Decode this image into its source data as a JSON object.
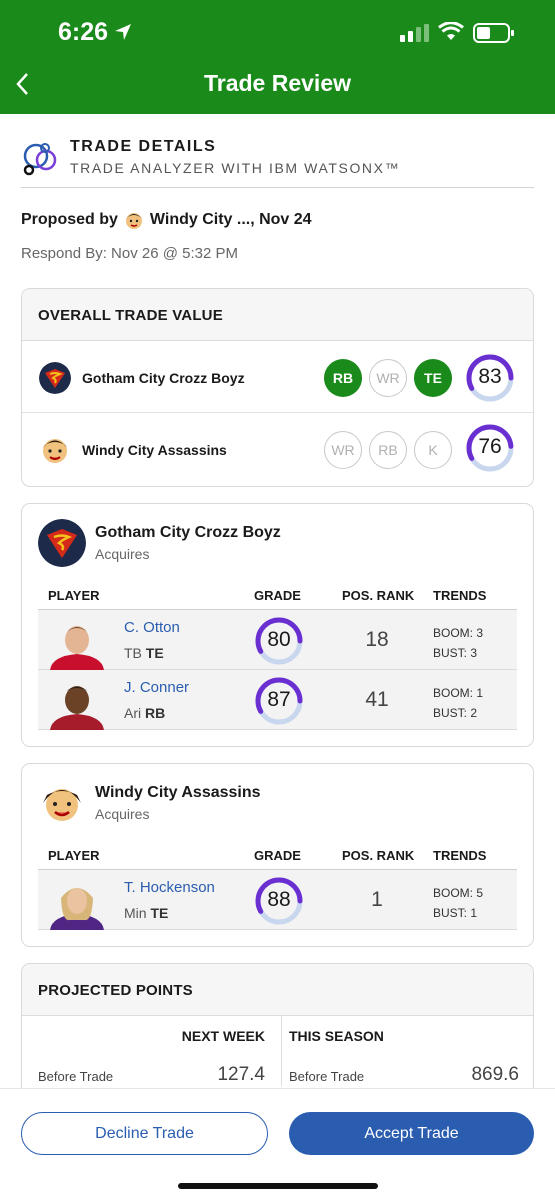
{
  "status_bar": {
    "time": "6:26"
  },
  "nav": {
    "title": "Trade Review"
  },
  "trade_details": {
    "title": "TRADE DETAILS",
    "subtitle": "TRADE ANALYZER WITH IBM WATSONX™"
  },
  "proposed": {
    "prefix": "Proposed by",
    "team": "Windy City ..., Nov 24"
  },
  "respond_by": "Respond By: Nov 26 @ 5:32 PM",
  "overall_trade_value": {
    "title": "OVERALL TRADE VALUE",
    "rows": [
      {
        "team": "Gotham City Crozz Boyz",
        "positions": [
          "RB",
          "WR",
          "TE"
        ],
        "active": [
          true,
          false,
          true
        ],
        "score": "83"
      },
      {
        "team": "Windy City Assassins",
        "positions": [
          "WR",
          "RB",
          "K"
        ],
        "active": [
          false,
          false,
          false
        ],
        "score": "76"
      }
    ]
  },
  "acquisitions": [
    {
      "team": "Gotham City Crozz Boyz",
      "label": "Acquires",
      "headers": {
        "player": "PLAYER",
        "grade": "GRADE",
        "rank": "POS. RANK",
        "trends": "TRENDS"
      },
      "players": [
        {
          "name": "C. Otton",
          "team": "TB",
          "pos": "TE",
          "grade": "80",
          "rank": "18",
          "boom": "BOOM: 3",
          "bust": "BUST: 3"
        },
        {
          "name": "J. Conner",
          "team": "Ari",
          "pos": "RB",
          "grade": "87",
          "rank": "41",
          "boom": "BOOM: 1",
          "bust": "BUST: 2"
        }
      ]
    },
    {
      "team": "Windy City Assassins",
      "label": "Acquires",
      "headers": {
        "player": "PLAYER",
        "grade": "GRADE",
        "rank": "POS. RANK",
        "trends": "TRENDS"
      },
      "players": [
        {
          "name": "T. Hockenson",
          "team": "Min",
          "pos": "TE",
          "grade": "88",
          "rank": "1",
          "boom": "BOOM: 5",
          "bust": "BUST: 1"
        }
      ]
    }
  ],
  "projected_points": {
    "title": "PROJECTED POINTS",
    "next_week": {
      "header": "NEXT WEEK",
      "label": "Before Trade",
      "value": "127.4"
    },
    "this_season": {
      "header": "THIS SEASON",
      "label": "Before Trade",
      "value": "869.6"
    }
  },
  "actions": {
    "decline": "Decline Trade",
    "accept": "Accept Trade"
  },
  "colors": {
    "header_green": "#1a8a1a",
    "link_blue": "#2a5db0",
    "gauge_purple": "#6a2fd1",
    "gauge_track": "#c9d7ee"
  }
}
